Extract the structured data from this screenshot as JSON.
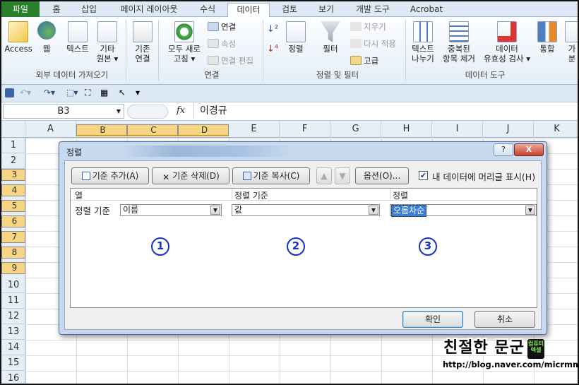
{
  "tabs": [
    "파일",
    "홈",
    "삽입",
    "페이지 레이아웃",
    "수식",
    "데이터",
    "검토",
    "보기",
    "개발 도구",
    "Acrobat"
  ],
  "ribbon": {
    "access": "Access",
    "web": "웹",
    "text": "텍스트",
    "other_1": "기타",
    "other_2": "원본",
    "existing_1": "기존",
    "existing_2": "연결",
    "refresh_1": "모두 새로",
    "refresh_2": "고침",
    "connections": "연결",
    "properties": "속성",
    "edit_links": "연결 편집",
    "sort": "정렬",
    "filter": "필터",
    "clear": "지우기",
    "reapply": "다시 적용",
    "advanced": "고급",
    "text_to_col_1": "텍스트",
    "text_to_col_2": "나누기",
    "dup_1": "중복된",
    "dup_2": "항목 제거",
    "valid_1": "데이터",
    "valid_2": "유효성 검사",
    "consolidate": "통합",
    "more_1": "가",
    "more_2": "분",
    "group_external": "외부 데이터 가져오기",
    "group_conn": "연결",
    "group_sort": "정렬 및 필터",
    "group_tools": "데이터 도구"
  },
  "formula": {
    "namebox": "B3",
    "fx": "fx",
    "value": "이경규"
  },
  "columns": [
    "A",
    "B",
    "C",
    "D",
    "E",
    "F",
    "G",
    "H",
    "I",
    "J",
    "K"
  ],
  "rows": [
    "1",
    "2",
    "3",
    "4",
    "5",
    "6",
    "7",
    "8",
    "9",
    "10",
    "11",
    "12",
    "13",
    "14",
    "15",
    "16"
  ],
  "dialog": {
    "title": "정렬",
    "help": "?",
    "close": "X",
    "add_level": "기준 추가(A)",
    "delete_level": "기준 삭제(D)",
    "copy_level": "기준 복사(C)",
    "options": "옵션(O)...",
    "has_headers": "내 데이터에 머리글 표시(H)",
    "header_column": "열",
    "header_sort_on": "정렬 기준",
    "header_order": "정렬",
    "row_label": "정렬 기준",
    "column_value": "이름",
    "sort_on_value": "값",
    "order_value": "오름차순",
    "ok": "확인",
    "cancel": "취소",
    "marker1": "1",
    "marker2": "2",
    "marker3": "3"
  },
  "watermark": {
    "name": "친절한 문군",
    "badge": "컴퓨터 엑셀",
    "url": "http://blog.naver.com/micrmm"
  }
}
